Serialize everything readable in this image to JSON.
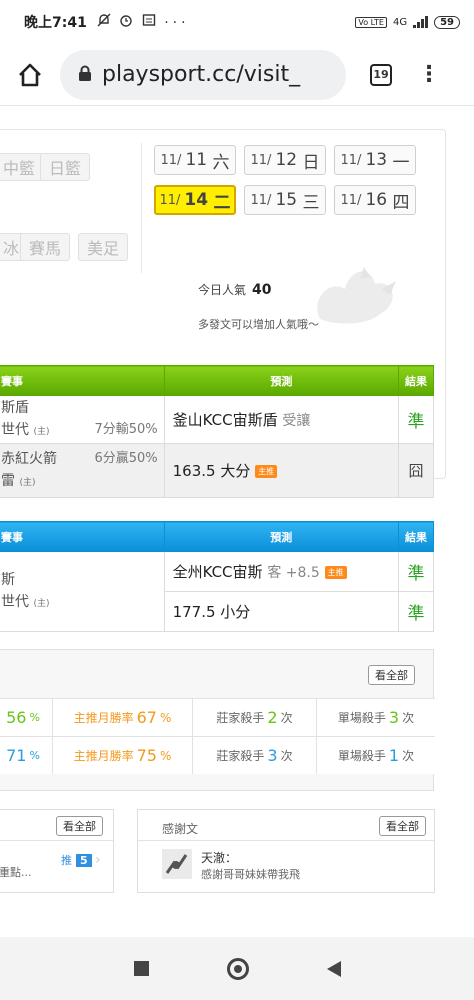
{
  "status": {
    "time": "晚上7:41",
    "notification_icons": "mute-bell alarm-clock message-box more",
    "network": "4G",
    "lte_label": "Vo LTE",
    "battery": "59"
  },
  "browser": {
    "url": "playsport.cc/visit_",
    "tab_count": "19"
  },
  "sports": {
    "row1": [
      "中籃",
      "日籃"
    ],
    "row2": [
      "冰",
      "賽馬",
      "美足"
    ]
  },
  "dates": [
    {
      "md": "11/",
      "day": "11",
      "dow": "六",
      "active": false
    },
    {
      "md": "11/",
      "day": "12",
      "dow": "日",
      "active": false
    },
    {
      "md": "11/",
      "day": "13",
      "dow": "一",
      "active": false
    },
    {
      "md": "11/",
      "day": "14",
      "dow": "二",
      "active": true
    },
    {
      "md": "11/",
      "day": "15",
      "dow": "三",
      "active": false
    },
    {
      "md": "11/",
      "day": "16",
      "dow": "四",
      "active": false
    }
  ],
  "popularity": {
    "label": "今日人氣",
    "value": "40",
    "hint": "多發文可以增加人氣哦～"
  },
  "table_headers": {
    "event": "賽事",
    "prediction": "預測",
    "result": "結果"
  },
  "green_table": {
    "rows": [
      {
        "team_line1": "斯盾",
        "team_line2": "世代",
        "tag": "(主)",
        "odds": "7分輸50%",
        "prediction": "釜山KCC宙斯盾",
        "prediction_sub": "受讓",
        "result": "準",
        "badge": ""
      },
      {
        "team_line1": "赤紅火箭",
        "team_line2": "雷",
        "tag": "(主)",
        "odds": "6分贏50%",
        "prediction": "163.5 大分",
        "prediction_sub": "",
        "result": "囧",
        "badge": "主推"
      }
    ]
  },
  "blue_table": {
    "team_line1": "斯",
    "team_line2": "世代",
    "tag": "(主)",
    "rows": [
      {
        "prediction": "全州KCC宙斯",
        "prediction_sub": "客 +8.5",
        "badge": "主推",
        "result": "準"
      },
      {
        "prediction": "177.5 小分",
        "prediction_sub": "",
        "badge": "",
        "result": "準"
      }
    ]
  },
  "stats": {
    "view_all": "看全部",
    "row1": {
      "first": "56",
      "first_unit": "%",
      "monthly_label": "主推月勝率",
      "monthly": "67",
      "monthly_unit": "%",
      "bookie_label": "莊家殺手",
      "bookie": "2",
      "bookie_unit": "次",
      "single_label": "單場殺手",
      "single": "3",
      "single_unit": "次"
    },
    "row2": {
      "first": "71",
      "first_unit": "%",
      "monthly_label": "主推月勝率",
      "monthly": "75",
      "monthly_unit": "%",
      "bookie_label": "莊家殺手",
      "bookie": "3",
      "bookie_unit": "次",
      "single_label": "單場殺手",
      "single": "1",
      "single_unit": "次"
    }
  },
  "left_box": {
    "view_all": "看全部",
    "text": "重點...",
    "push_label": "推",
    "push_count": "5"
  },
  "thanks_box": {
    "title": "感謝文",
    "view_all": "看全部",
    "name": "天澈：",
    "message": "感謝哥哥妹妹帶我飛"
  },
  "colors": {
    "green_header": "#5aa800",
    "blue_header": "#0b8fd8",
    "active_date": "#ffee00",
    "win": "#2aa321",
    "orange": "#f39a1e"
  }
}
